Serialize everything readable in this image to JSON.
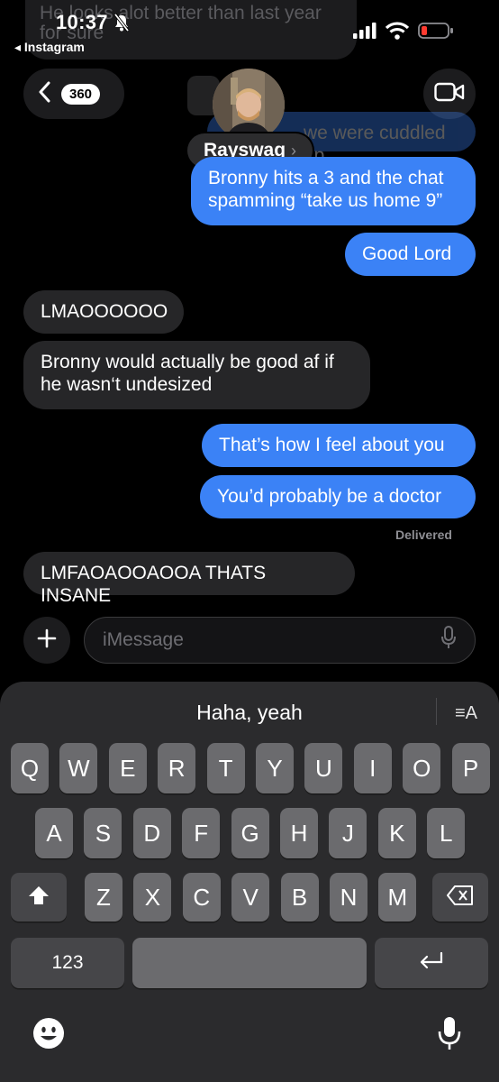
{
  "status_bar": {
    "time": "10:37",
    "back_app_label": "◂ Instagram",
    "ghost_lines": [
      "He looks alot better than last year",
      "for sure"
    ]
  },
  "header": {
    "unread_count": "360",
    "contact_name": "Rayswag",
    "name_chevron": "›"
  },
  "messages": [
    {
      "id": "m0",
      "direction": "sent",
      "text": "we were cuddled up"
    },
    {
      "id": "m1",
      "direction": "sent",
      "text": "Bronny hits a 3 and the chat spamming “take us home 9”"
    },
    {
      "id": "m2",
      "direction": "sent",
      "text": "Good Lord"
    },
    {
      "id": "m3",
      "direction": "received",
      "text": "LMAOOOOOO"
    },
    {
      "id": "m4",
      "direction": "received",
      "text": "Bronny would actually be good af if he wasn‘t undesized"
    },
    {
      "id": "m5",
      "direction": "sent",
      "text": "That’s how I feel about you"
    },
    {
      "id": "m6",
      "direction": "sent",
      "text": "You’d probably be a doctor"
    },
    {
      "id": "m7",
      "direction": "received",
      "text": "LMFAOAOOAOOA THATS INSANE"
    }
  ],
  "delivery_status": "Delivered",
  "composer": {
    "placeholder": "iMessage"
  },
  "keyboard": {
    "suggestion": "Haha, yeah",
    "format_label": "≡A",
    "row1": [
      "Q",
      "W",
      "E",
      "R",
      "T",
      "Y",
      "U",
      "I",
      "O",
      "P"
    ],
    "row2": [
      "A",
      "S",
      "D",
      "F",
      "G",
      "H",
      "J",
      "K",
      "L"
    ],
    "row3": [
      "Z",
      "X",
      "C",
      "V",
      "B",
      "N",
      "M"
    ],
    "numbers_label": "123"
  },
  "colors": {
    "sent_bubble": "#3b82f6",
    "received_bubble": "#262628",
    "background": "#000000"
  },
  "icons": [
    "bell-slash-icon",
    "signal-icon",
    "wifi-icon",
    "battery-low-icon",
    "chevron-left-icon",
    "video-camera-icon",
    "plus-icon",
    "microphone-icon",
    "shift-icon",
    "backspace-icon",
    "return-icon",
    "emoji-icon",
    "dictation-icon"
  ]
}
